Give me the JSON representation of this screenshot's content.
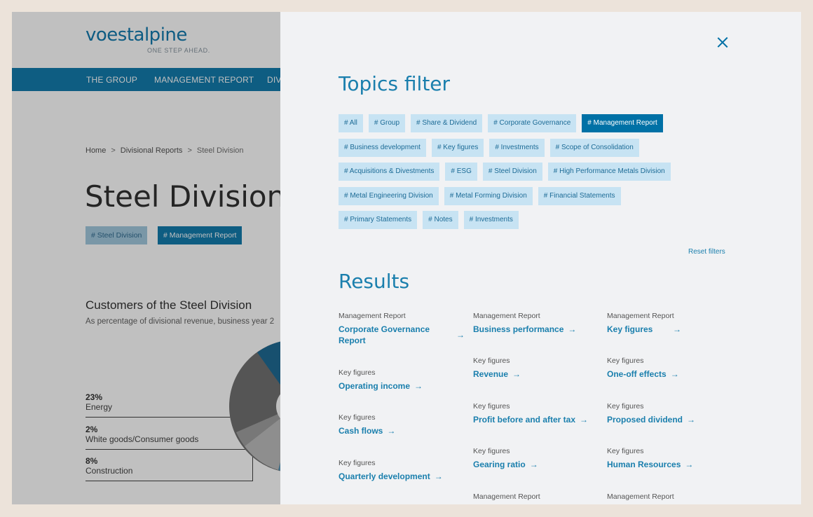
{
  "logo": {
    "word": "voestalpine",
    "tagline": "ONE STEP AHEAD."
  },
  "nav": {
    "items": [
      "THE GROUP",
      "MANAGEMENT REPORT",
      "DIV"
    ]
  },
  "breadcrumb": {
    "items": [
      "Home",
      "Divisional Reports",
      "Steel Division"
    ],
    "separator": ">"
  },
  "page": {
    "title": "Steel Division",
    "tags": [
      "# Steel Division",
      "# Management Report"
    ]
  },
  "chart": {
    "title": "Customers of the Steel Division",
    "subtitle": "As percentage of divisional revenue, business year 2",
    "segments": [
      {
        "pct": "23%",
        "label": "Energy"
      },
      {
        "pct": "2%",
        "label": "White goods/Consumer goods"
      },
      {
        "pct": "8%",
        "label": "Construction"
      }
    ]
  },
  "chart_data": {
    "type": "pie",
    "title": "Customers of the Steel Division",
    "subtitle": "As percentage of divisional revenue, business year 2",
    "categories": [
      "Energy",
      "White goods/Consumer goods",
      "Construction"
    ],
    "values": [
      23,
      2,
      8
    ],
    "unit": "%"
  },
  "filter": {
    "title": "Topics filter",
    "tags": [
      [
        "# All",
        "# Group",
        "# Share & Dividend",
        "# Corporate Governance",
        "# Management Report"
      ],
      [
        "# Business development",
        "# Key figures",
        "# Investments",
        "# Scope of Consolidation"
      ],
      [
        "# Acquisitions & Divestments",
        "# ESG",
        "# Steel Division",
        "# High Performance Metals Division"
      ],
      [
        "# Metal Engineering Division",
        "# Metal Forming Division",
        "# Financial Statements"
      ],
      [
        "# Primary Statements",
        "# Notes",
        "# Investments"
      ]
    ],
    "active": "# Management Report",
    "reset_label": "Reset filters"
  },
  "results": {
    "title": "Results",
    "arrow": "→",
    "col1": [
      {
        "category": "Management Report",
        "link": "Corporate Governance Report"
      },
      {
        "category": "Key figures",
        "link": "Operating income"
      },
      {
        "category": "Key figures",
        "link": "Cash flows"
      },
      {
        "category": "Key figures",
        "link": "Quarterly development"
      }
    ],
    "col2": [
      {
        "category": "Management Report",
        "link": "Business performance"
      },
      {
        "category": "Key figures",
        "link": "Revenue"
      },
      {
        "category": "Key figures",
        "link": "Profit before and after tax"
      },
      {
        "category": "Key figures",
        "link": "Gearing ratio"
      },
      {
        "category": "Management Report",
        "link": ""
      }
    ],
    "col3": [
      {
        "category": "Management Report",
        "link": "Key figures"
      },
      {
        "category": "Key figures",
        "link": "One-off effects"
      },
      {
        "category": "Key figures",
        "link": "Proposed dividend"
      },
      {
        "category": "Key figures",
        "link": "Human Resources"
      },
      {
        "category": "Management Report",
        "link": ""
      }
    ]
  },
  "colors": {
    "brand_blue": "#0071a6",
    "link_blue": "#1a7fad",
    "tag_bg": "#c7e3f3",
    "page_bg": "#ece3da",
    "panel_bg": "#f1f2f4"
  },
  "icons": {
    "close": "close-icon",
    "arrow": "arrow-right-icon"
  }
}
